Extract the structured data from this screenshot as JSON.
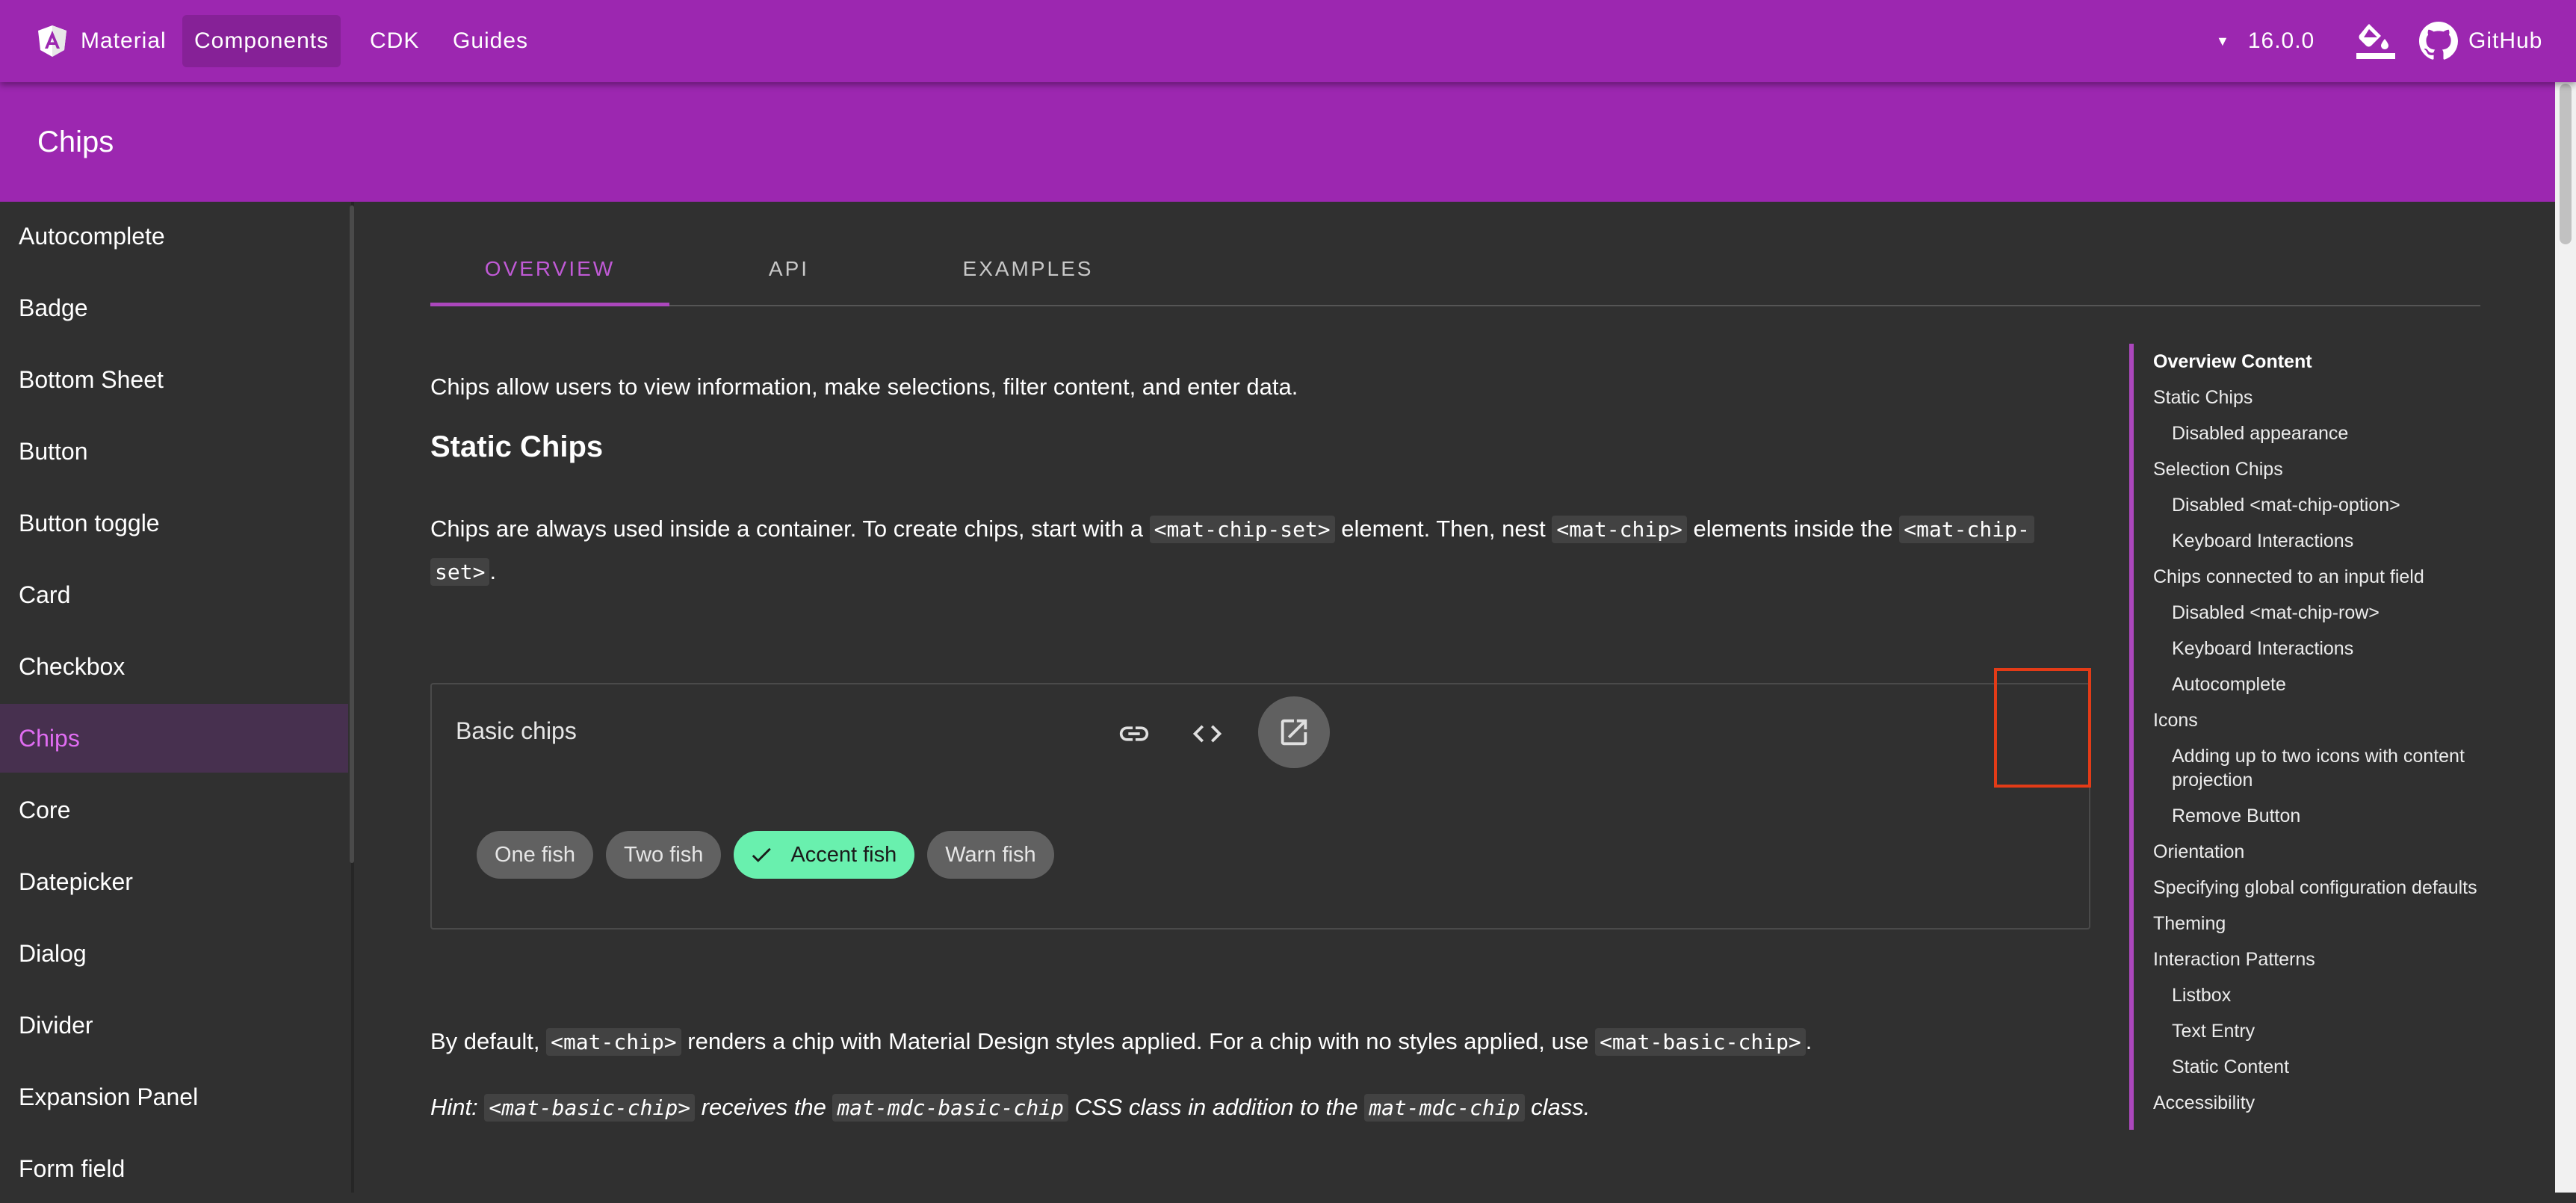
{
  "nav": {
    "brand": "Material",
    "items": [
      "Components",
      "CDK",
      "Guides"
    ],
    "version": "16.0.0",
    "github": "GitHub"
  },
  "page": {
    "title": "Chips"
  },
  "sidebar": {
    "items": [
      "Autocomplete",
      "Badge",
      "Bottom Sheet",
      "Button",
      "Button toggle",
      "Card",
      "Checkbox",
      "Chips",
      "Core",
      "Datepicker",
      "Dialog",
      "Divider",
      "Expansion Panel",
      "Form field"
    ],
    "active": "Chips"
  },
  "tabs": [
    "OVERVIEW",
    "API",
    "EXAMPLES"
  ],
  "content": {
    "intro": "Chips allow users to view information, make selections, filter content, and enter data.",
    "static_heading": "Static Chips",
    "p1_a": "Chips are always used inside a container. To create chips, start with a ",
    "p1_code1": "<mat-chip-set>",
    "p1_b": " element. Then, nest ",
    "p1_code2": "<mat-chip>",
    "p1_c": " elements inside the ",
    "p1_code3a": "<mat-chip-",
    "p1_code3b": "set>",
    "p1_d": ".",
    "example_title": "Basic chips",
    "chips": [
      "One fish",
      "Two fish",
      "Accent fish",
      "Warn fish"
    ],
    "p2_a": "By default, ",
    "p2_code1": "<mat-chip>",
    "p2_b": " renders a chip with Material Design styles applied. For a chip with no styles applied, use ",
    "p2_code2": "<mat-basic-chip>",
    "p2_c": ".",
    "hint_a": "Hint: ",
    "hint_code1": "<mat-basic-chip>",
    "hint_b": " receives the ",
    "hint_code2": "mat-mdc-basic-chip",
    "hint_c": " CSS class in addition to the ",
    "hint_code3": "mat-mdc-chip",
    "hint_d": " class."
  },
  "toc": {
    "heading": "Overview Content",
    "items": [
      {
        "label": "Static Chips",
        "level": 1
      },
      {
        "label": "Disabled appearance",
        "level": 2
      },
      {
        "label": "Selection Chips",
        "level": 1
      },
      {
        "label": "Disabled <mat-chip-option>",
        "level": 2
      },
      {
        "label": "Keyboard Interactions",
        "level": 2
      },
      {
        "label": "Chips connected to an input field",
        "level": 1
      },
      {
        "label": "Disabled <mat-chip-row>",
        "level": 2
      },
      {
        "label": "Keyboard Interactions",
        "level": 2
      },
      {
        "label": "Autocomplete",
        "level": 2
      },
      {
        "label": "Icons",
        "level": 1
      },
      {
        "label": "Adding up to two icons with content",
        "level": 2
      },
      {
        "label": "projection",
        "level": 2
      },
      {
        "label": "Remove Button",
        "level": 2
      },
      {
        "label": "Orientation",
        "level": 1
      },
      {
        "label": "Specifying global configuration defaults",
        "level": 1
      },
      {
        "label": "Theming",
        "level": 1
      },
      {
        "label": "Interaction Patterns",
        "level": 1
      },
      {
        "label": "Listbox",
        "level": 2
      },
      {
        "label": "Text Entry",
        "level": 2
      },
      {
        "label": "Static Content",
        "level": 2
      },
      {
        "label": "Accessibility",
        "level": 1
      }
    ]
  },
  "colors": {
    "primary": "#9c27b0",
    "accent_chip": "#69f0ae",
    "highlight": "#e33b17",
    "background": "#303030"
  }
}
